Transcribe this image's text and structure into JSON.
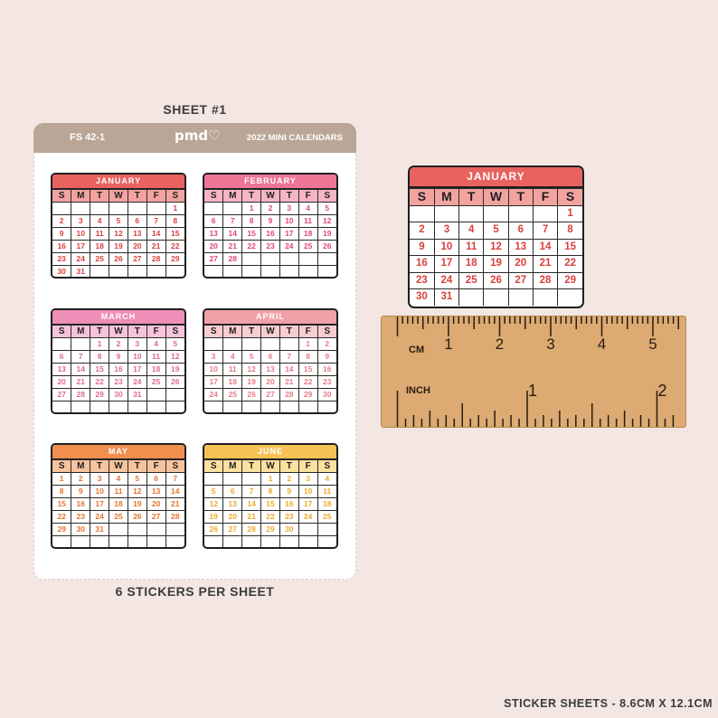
{
  "sheet": {
    "title": "SHEET #1",
    "code": "FS 42-1",
    "logo": "pmd♡",
    "name": "2022 MINI CALENDARS",
    "footer": "6 STICKERS PER SHEET"
  },
  "size_caption": "STICKER SHEETS - 8.6CM X 12.1CM",
  "weekdays": [
    "S",
    "M",
    "T",
    "W",
    "T",
    "F",
    "S"
  ],
  "calendars": [
    {
      "label": "JANUARY",
      "offset": 6,
      "days": 31,
      "header_color": "#e8625f",
      "subheader_color": "#f2a3a0",
      "number_color": "#d9403c"
    },
    {
      "label": "FEBRUARY",
      "offset": 2,
      "days": 28,
      "header_color": "#ee7595",
      "subheader_color": "#f6b5c6",
      "number_color": "#e0476f"
    },
    {
      "label": "MARCH",
      "offset": 2,
      "days": 31,
      "header_color": "#ee8fb8",
      "subheader_color": "#f6c3da",
      "number_color": "#e0689c"
    },
    {
      "label": "APRIL",
      "offset": 5,
      "days": 30,
      "header_color": "#f1a0a8",
      "subheader_color": "#f8cdd1",
      "number_color": "#e87a85"
    },
    {
      "label": "MAY",
      "offset": 0,
      "days": 31,
      "header_color": "#f08f4e",
      "subheader_color": "#f7c49e",
      "number_color": "#e6722b"
    },
    {
      "label": "JUNE",
      "offset": 3,
      "days": 30,
      "header_color": "#f7c255",
      "subheader_color": "#fbe19f",
      "number_color": "#efa92a"
    }
  ],
  "ruler": {
    "cm_label": "CM",
    "inch_label": "INCH",
    "cm_numbers": [
      "1",
      "2",
      "3",
      "4",
      "5"
    ],
    "inch_numbers": [
      "1",
      "2"
    ]
  }
}
